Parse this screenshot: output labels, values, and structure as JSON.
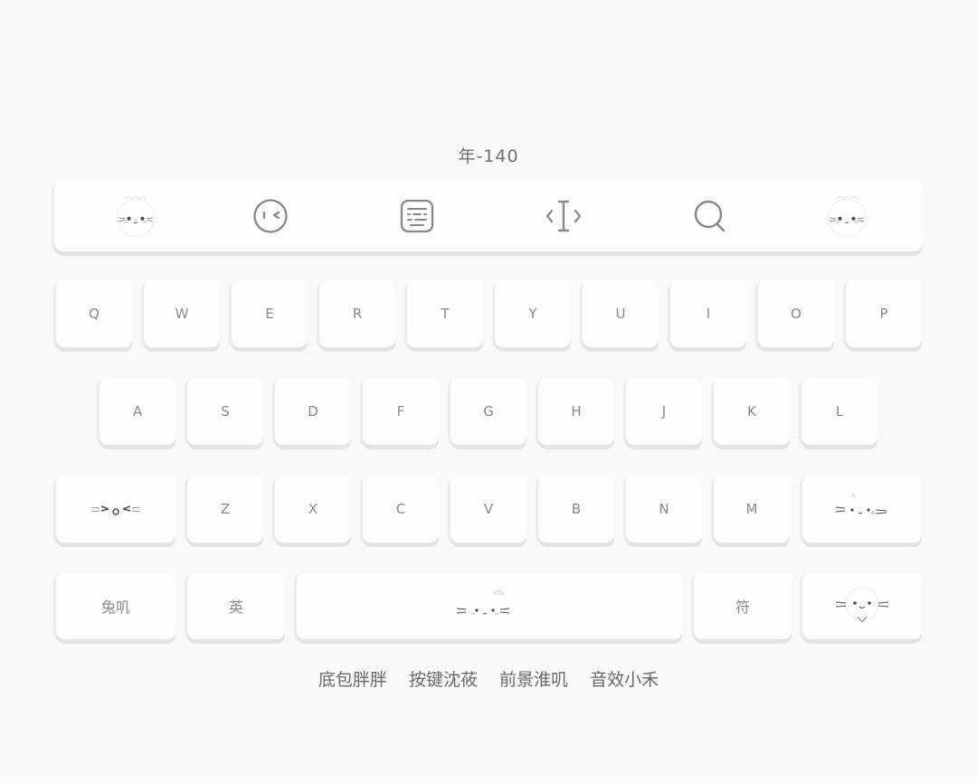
{
  "header": {
    "title": "年-140"
  },
  "toolbar": {
    "icons": [
      "cat-avatar-icon",
      "emoji-icon",
      "keyboard-icon",
      "cursor-move-icon",
      "search-icon",
      "cat-avatar-icon"
    ]
  },
  "keyboard": {
    "row1": [
      "Q",
      "W",
      "E",
      "R",
      "T",
      "Y",
      "U",
      "I",
      "O",
      "P"
    ],
    "row2": [
      "A",
      "S",
      "D",
      "F",
      "G",
      "H",
      "J",
      "K",
      "L"
    ],
    "row3": [
      "Z",
      "X",
      "C",
      "V",
      "B",
      "N",
      "M"
    ],
    "bottom": {
      "mode_label": "兔叽",
      "lang_label": "英",
      "symbol_label": "符"
    }
  },
  "footer": {
    "credits": [
      "底包胖胖",
      "按键沈莜",
      "前景淮叽",
      "音效小禾"
    ]
  },
  "colors": {
    "background": "#f9f9f9",
    "key": "#fdfdfd",
    "key_shadow": "#e4e4e4",
    "text": "#8a8a8a"
  }
}
